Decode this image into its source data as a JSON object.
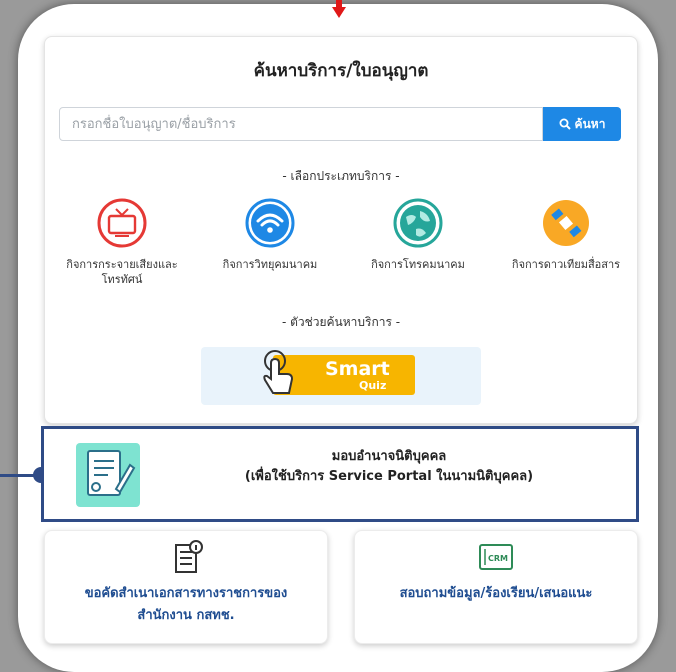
{
  "search": {
    "title": "ค้นหาบริการ/ใบอนุญาต",
    "placeholder": "กรอกชื่อใบอนุญาต/ชื่อบริการ",
    "button_label": "ค้นหา",
    "category_heading": "- เลือกประเภทบริการ -",
    "categories": [
      {
        "label": "กิจการกระจายเสียงและโทรทัศน์",
        "icon": "tv-icon",
        "color": "#e53935"
      },
      {
        "label": "กิจการวิทยุคมนาคม",
        "icon": "wifi-icon",
        "color": "#1e88e5"
      },
      {
        "label": "กิจการโทรคมนาคม",
        "icon": "globe-icon",
        "color": "#26a69a"
      },
      {
        "label": "กิจการดาวเทียมสื่อสาร",
        "icon": "satellite-icon",
        "color": "#f9a825"
      }
    ],
    "helper_heading": "- ตัวช่วยค้นหาบริการ -",
    "smart_quiz": {
      "title": "Smart",
      "subtitle": "Quiz"
    }
  },
  "power_of_attorney": {
    "title": "มอบอำนาจนิติบุคคล",
    "subtitle": "(เพื่อใช้บริการ Service Portal ในนามนิติบุคคล)",
    "icon": "document-sign-icon"
  },
  "bottom_buttons": [
    {
      "line1": "ขอคัดสำเนาเอกสารทางราชการของ",
      "line2": "สำนักงาน กสทช.",
      "icon": "document-info-icon"
    },
    {
      "line1": "สอบถามข้อมูล/ร้องเรียน/เสนอแนะ",
      "icon": "crm-icon",
      "icon_text": "CRM"
    }
  ],
  "colors": {
    "accent": "#1e88e5",
    "border_highlight": "#2f4b86",
    "link_text": "#1f4d91",
    "alert_arrow": "#e01818"
  }
}
